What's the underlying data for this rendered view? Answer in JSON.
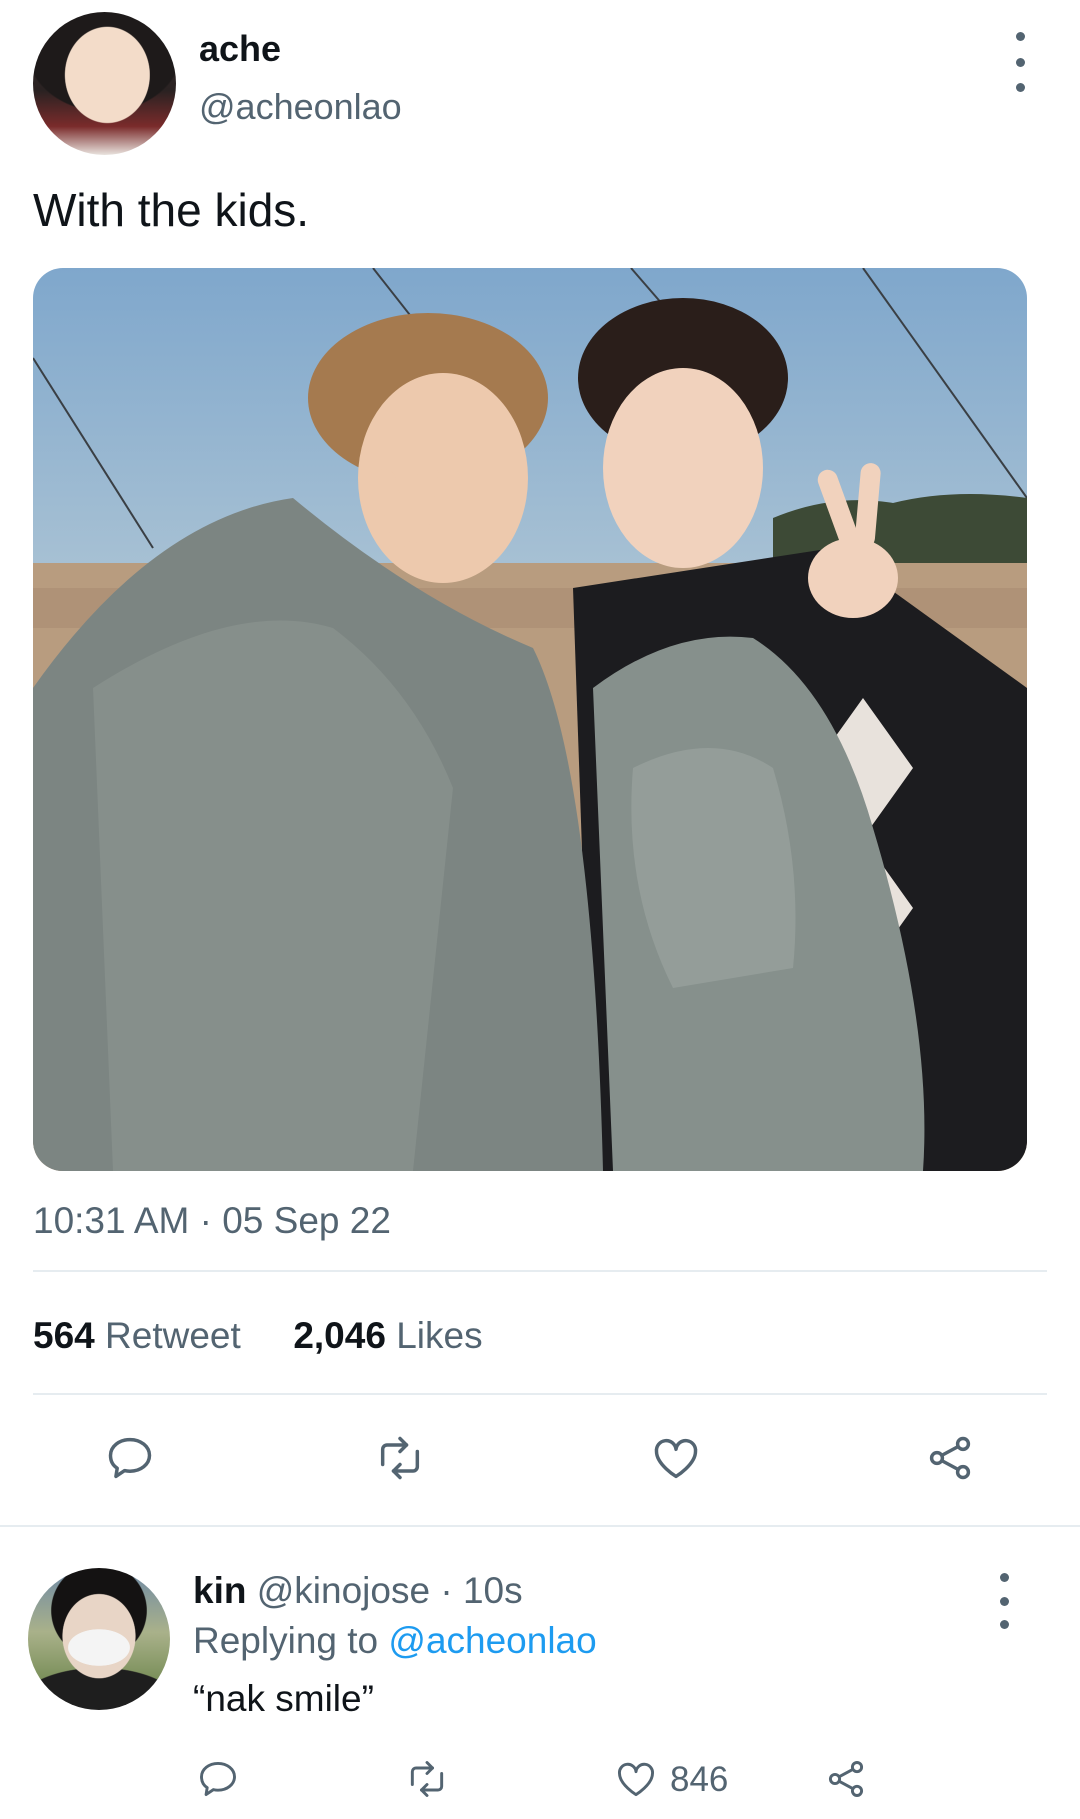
{
  "tweet": {
    "author_name": "ache",
    "author_handle": "@acheonlao",
    "text": "With the kids.",
    "time": "10:31 AM",
    "date_sep": "·",
    "date": "05 Sep 22",
    "retweet_count": "564",
    "retweet_label": "Retweet",
    "like_count": "2,046",
    "like_label": "Likes"
  },
  "reply": {
    "author_name": "kin",
    "author_handle": "@kinojose",
    "sep": "·",
    "time": "10s",
    "replying_prefix": "Replying to",
    "replying_to": "@acheonlao",
    "text": "“nak smile”",
    "like_count": "846"
  },
  "colors": {
    "secondary_text": "#536471",
    "mention": "#1d9bf0",
    "divider": "#e6ecf0"
  },
  "icons": [
    "more-icon",
    "reply-icon",
    "retweet-icon",
    "like-icon",
    "share-icon"
  ]
}
